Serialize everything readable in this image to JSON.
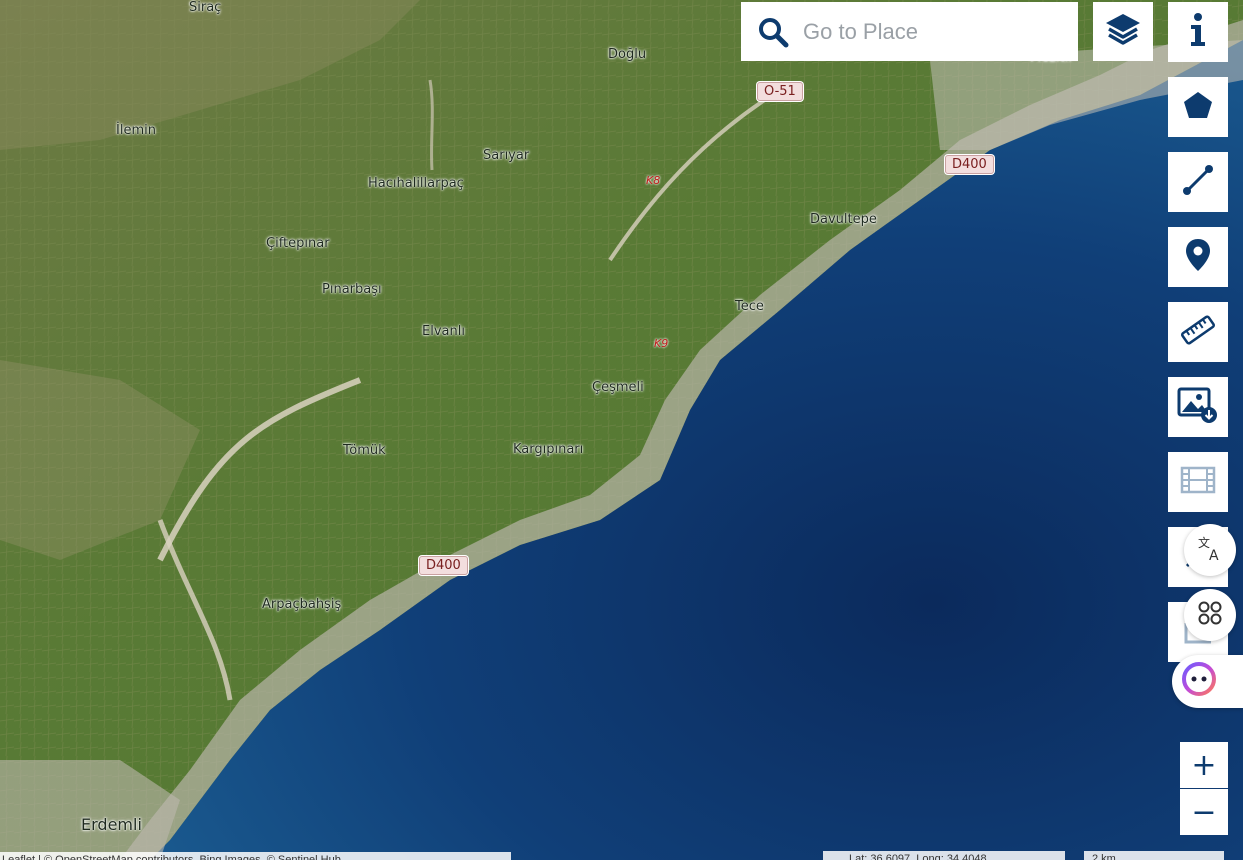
{
  "search": {
    "placeholder": "Go to Place"
  },
  "places": [
    "Siraç",
    "Doğlu",
    "İlemin",
    "Sarıyar",
    "Hacıhalillarpaç",
    "Davultepe",
    "Çiftepınar",
    "Pınarbaşı",
    "Elvanlı",
    "Tece",
    "Çeşmeli",
    "Tömük",
    "Kargıpınarı",
    "Arpaçbahşiş",
    "Erdemli",
    "Mezitli"
  ],
  "roads": {
    "o51": "O-51",
    "d400_east": "D400",
    "d400_west": "D400",
    "k8": "K8",
    "k9": "K9"
  },
  "zoom": {
    "in": "+",
    "out": "−"
  },
  "footer": {
    "attribution": "Leaflet | © OpenStreetMap contributors, Bing Images, © Sentinel Hub",
    "coords": "Lat: 36.6097, Long: 34.4048",
    "scale": "2 km"
  },
  "colors": {
    "accent": "#0d3b6e",
    "sea": "#0f3e78",
    "land": "#5c7a3a"
  },
  "icons": {
    "search": "search-icon",
    "layers": "layers-icon",
    "info": "info-icon",
    "polygon": "polygon-icon",
    "line": "line-icon",
    "marker": "marker-icon",
    "ruler": "ruler-icon",
    "image_download": "image-download-icon",
    "film": "film-icon",
    "translate": "translate-icon",
    "apps": "apps-icon",
    "assistant": "assistant-icon"
  }
}
